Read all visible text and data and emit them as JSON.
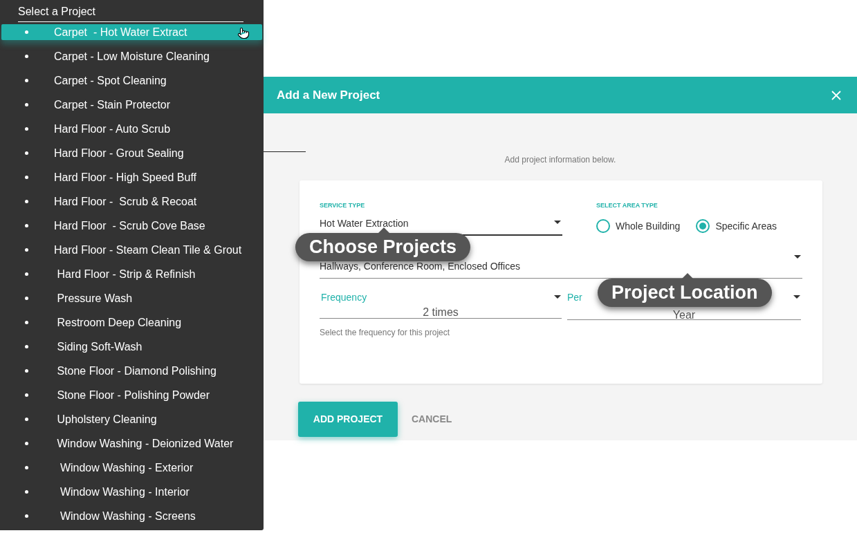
{
  "project_menu": {
    "title": "Select a Project",
    "items": [
      {
        "label": "Carpet  - Hot Water Extract",
        "selected": true
      },
      {
        "label": "Carpet - Low Moisture Cleaning",
        "selected": false
      },
      {
        "label": "Carpet - Spot Cleaning",
        "selected": false
      },
      {
        "label": "Carpet - Stain Protector",
        "selected": false
      },
      {
        "label": "Hard Floor - Auto Scrub",
        "selected": false
      },
      {
        "label": "Hard Floor - Grout Sealing",
        "selected": false
      },
      {
        "label": "Hard Floor - High Speed Buff",
        "selected": false
      },
      {
        "label": "Hard Floor -  Scrub & Recoat",
        "selected": false
      },
      {
        "label": "Hard Floor  - Scrub Cove Base",
        "selected": false
      },
      {
        "label": "Hard Floor - Steam Clean Tile & Grout",
        "selected": false
      },
      {
        "label": " Hard Floor - Strip & Refinish",
        "selected": false
      },
      {
        "label": " Pressure Wash",
        "selected": false
      },
      {
        "label": " Restroom Deep Cleaning",
        "selected": false
      },
      {
        "label": " Siding Soft-Wash",
        "selected": false
      },
      {
        "label": " Stone Floor - Diamond Polishing",
        "selected": false
      },
      {
        "label": " Stone Floor - Polishing Powder",
        "selected": false
      },
      {
        "label": " Upholstery Cleaning",
        "selected": false
      },
      {
        "label": " Window Washing - Deionized Water",
        "selected": false
      },
      {
        "label": "  Window Washing - Exterior",
        "selected": false
      },
      {
        "label": "  Window Washing - Interior",
        "selected": false
      },
      {
        "label": "  Window Washing - Screens",
        "selected": false
      }
    ]
  },
  "dialog": {
    "title": "Add a New Project",
    "intro": "Add project information below.",
    "service_type": {
      "label": "SERVICE TYPE",
      "value": "Hot Water Extraction"
    },
    "area_type": {
      "label": "SELECT AREA TYPE",
      "options": [
        {
          "label": "Whole Building",
          "selected": false
        },
        {
          "label": "Specific Areas",
          "selected": true
        }
      ]
    },
    "specific_areas": {
      "value": "Hallways, Conference Room, Enclosed Offices"
    },
    "frequency": {
      "label": "Frequency",
      "value": "2 times",
      "helper": "Select the frequency for this project"
    },
    "per": {
      "label": "Per",
      "value": "Year"
    },
    "buttons": [
      {
        "label": "ADD PROJECT",
        "kind": "primary"
      },
      {
        "label": "CANCEL",
        "kind": "text"
      }
    ]
  },
  "tooltips": [
    {
      "text": "Choose Projects"
    },
    {
      "text": "Project Location"
    }
  ]
}
